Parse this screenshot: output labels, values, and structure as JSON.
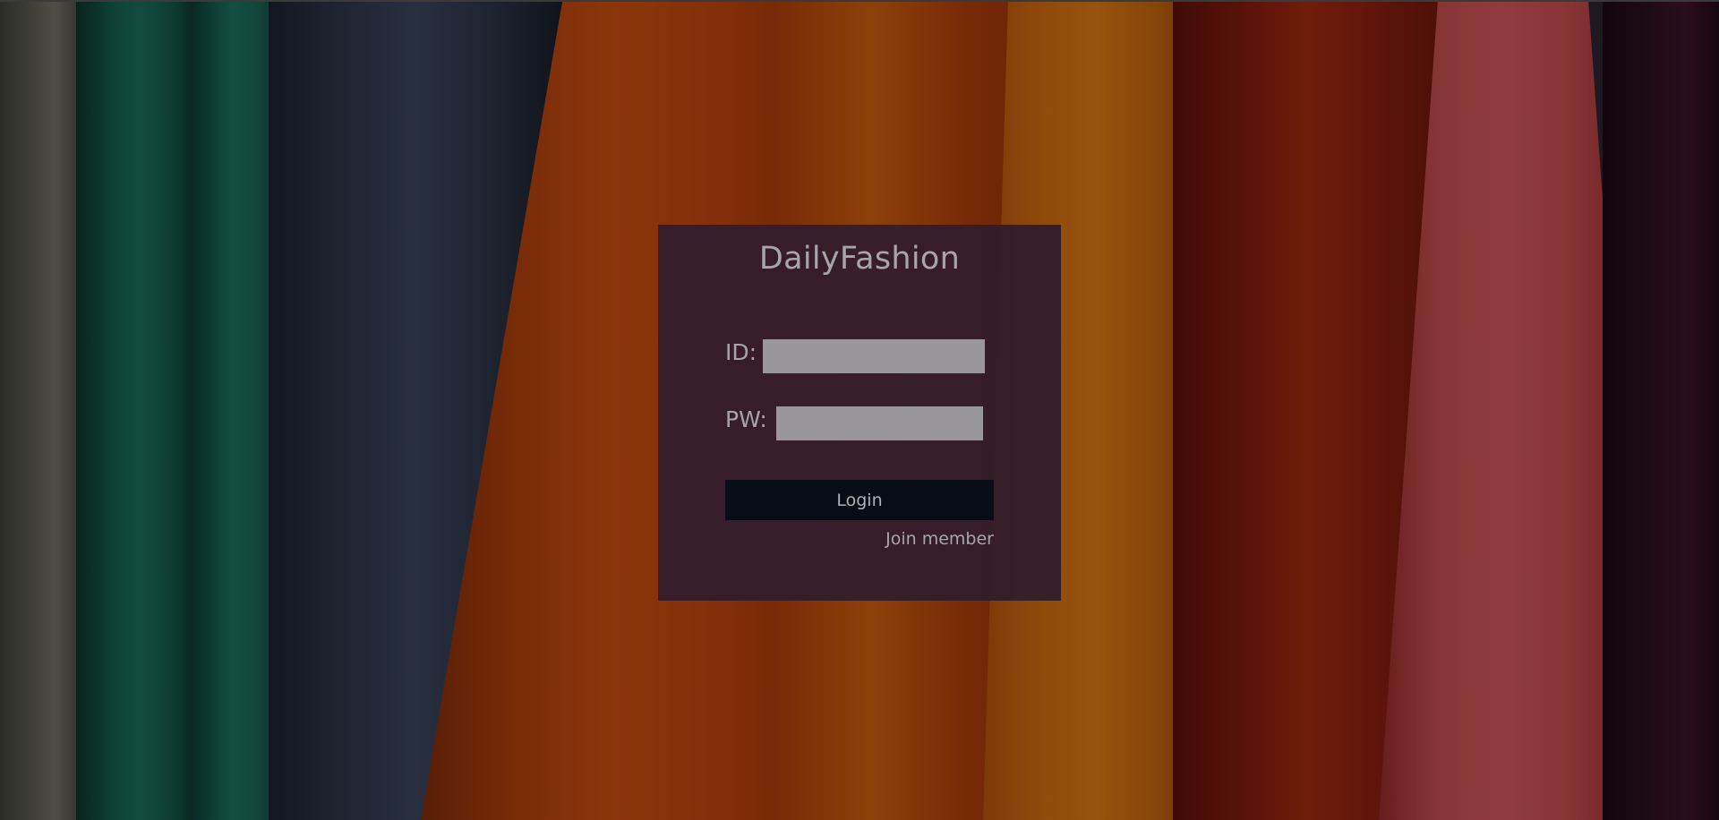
{
  "app": {
    "brand_title": "DailyFashion"
  },
  "form": {
    "id_label": "ID:",
    "id_value": "",
    "pw_label": "PW:",
    "pw_value": "",
    "login_label": "Login",
    "join_label": "Join member"
  },
  "colors": {
    "panel_bg": "#301c2c",
    "input_bg": "#999799",
    "button_bg": "#070c16",
    "text": "#a9a4ac"
  }
}
